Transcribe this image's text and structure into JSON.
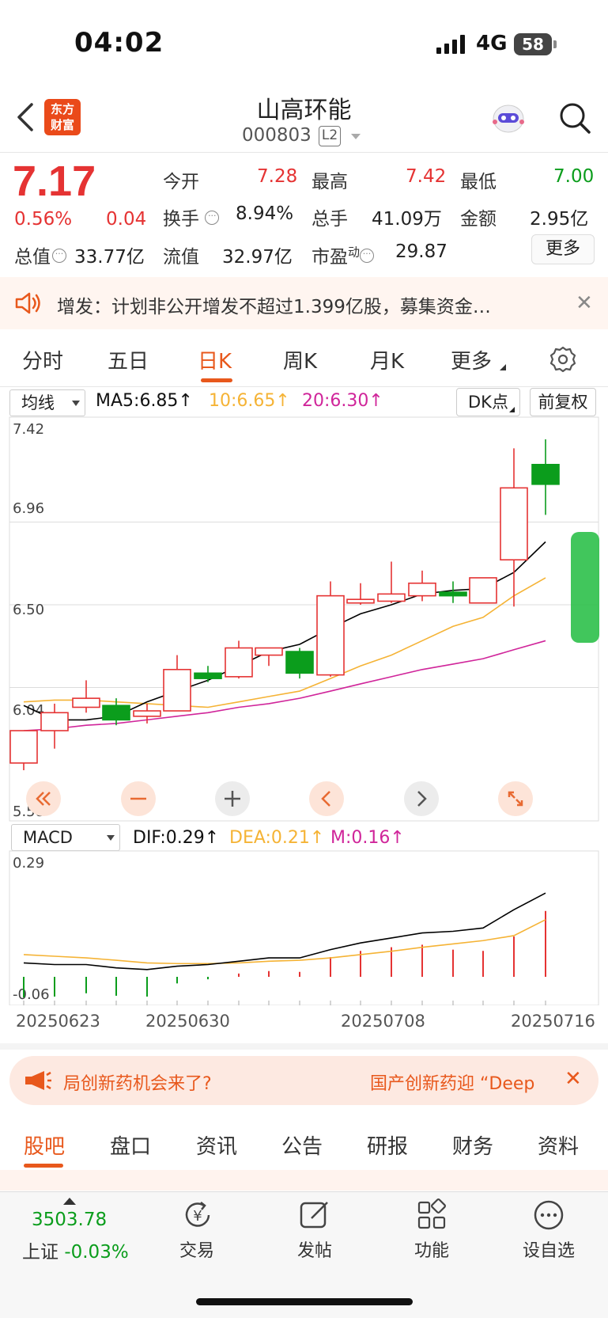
{
  "status_bar": {
    "time": "04:02",
    "network": "4G",
    "battery": "58"
  },
  "header": {
    "stock_name": "山高环能",
    "stock_code": "000803",
    "level_badge": "L2",
    "logo_text": "东方财富"
  },
  "quote": {
    "price": "7.17",
    "change_pct": "0.56%",
    "change": "0.04",
    "open_label": "今开",
    "open": "7.28",
    "high_label": "最高",
    "high": "7.42",
    "low_label": "最低",
    "low": "7.00",
    "turnover_label": "换手",
    "turnover": "8.94%",
    "volume_label": "总手",
    "volume": "41.09万",
    "amount_label": "金额",
    "amount": "2.95亿",
    "total_mv_label": "总值",
    "total_mv": "33.77亿",
    "float_mv_label": "流值",
    "float_mv": "32.97亿",
    "pe_label": "市盈",
    "pe_sup": "动",
    "pe": "29.87",
    "more_button": "更多"
  },
  "notice": {
    "text": "增发：计划非公开增发不超过1.399亿股，募集资金…"
  },
  "chart_tabs": [
    "分时",
    "五日",
    "日K",
    "周K",
    "月K",
    "更多"
  ],
  "ma_row": {
    "select": "均线",
    "ma5": "MA5:6.85",
    "ma10": "10:6.65",
    "ma20": "20:6.30",
    "dk_button": "DK点",
    "fq_button": "前复权"
  },
  "colors": {
    "red": "#e53333",
    "green": "#0b9d1c",
    "accent": "#e8581c",
    "ma5": "#000000",
    "ma10": "#f5b335",
    "ma20": "#d0259a"
  },
  "chart_data": [
    {
      "type": "candlestick",
      "yticks": [
        "7.42",
        "6.96",
        "6.50",
        "6.04",
        "5.58"
      ],
      "ylim": [
        5.58,
        7.42
      ],
      "candles": [
        {
          "o": 5.62,
          "c": 5.8,
          "h": 5.8,
          "l": 5.58
        },
        {
          "o": 5.8,
          "c": 5.9,
          "h": 5.95,
          "l": 5.7
        },
        {
          "o": 5.93,
          "c": 5.98,
          "h": 6.08,
          "l": 5.9
        },
        {
          "o": 5.94,
          "c": 5.86,
          "h": 5.98,
          "l": 5.83
        },
        {
          "o": 5.88,
          "c": 5.91,
          "h": 5.95,
          "l": 5.84
        },
        {
          "o": 5.91,
          "c": 6.14,
          "h": 6.22,
          "l": 5.91
        },
        {
          "o": 6.12,
          "c": 6.09,
          "h": 6.16,
          "l": 6.07
        },
        {
          "o": 6.1,
          "c": 6.26,
          "h": 6.3,
          "l": 6.09
        },
        {
          "o": 6.22,
          "c": 6.26,
          "h": 6.26,
          "l": 6.16
        },
        {
          "o": 6.24,
          "c": 6.12,
          "h": 6.26,
          "l": 6.09
        },
        {
          "o": 6.11,
          "c": 6.55,
          "h": 6.63,
          "l": 6.1
        },
        {
          "o": 6.51,
          "c": 6.53,
          "h": 6.62,
          "l": 6.5
        },
        {
          "o": 6.52,
          "c": 6.56,
          "h": 6.74,
          "l": 6.51
        },
        {
          "o": 6.55,
          "c": 6.62,
          "h": 6.69,
          "l": 6.52
        },
        {
          "o": 6.57,
          "c": 6.55,
          "h": 6.63,
          "l": 6.51
        },
        {
          "o": 6.51,
          "c": 6.65,
          "h": 6.65,
          "l": 6.51
        },
        {
          "o": 6.75,
          "c": 7.15,
          "h": 7.37,
          "l": 6.49
        },
        {
          "o": 7.28,
          "c": 7.17,
          "h": 7.42,
          "l": 7.0
        }
      ],
      "ma5": [
        5.94,
        5.86,
        5.86,
        5.88,
        5.96,
        6.02,
        6.08,
        6.16,
        6.24,
        6.28,
        6.37,
        6.45,
        6.5,
        6.56,
        6.58,
        6.59,
        6.68,
        6.85
      ],
      "ma10": [
        5.96,
        5.97,
        5.97,
        5.96,
        5.95,
        5.94,
        5.93,
        5.96,
        5.99,
        6.02,
        6.09,
        6.16,
        6.22,
        6.3,
        6.38,
        6.43,
        6.55,
        6.65
      ],
      "ma20": [
        5.8,
        5.81,
        5.83,
        5.84,
        5.86,
        5.88,
        5.9,
        5.93,
        5.95,
        5.98,
        6.02,
        6.06,
        6.1,
        6.14,
        6.17,
        6.2,
        6.25,
        6.3
      ]
    },
    {
      "type": "macd",
      "yticks": [
        "0.29",
        "-0.06"
      ],
      "ylim": [
        -0.06,
        0.29
      ],
      "dif": [
        0.08,
        0.075,
        0.075,
        0.065,
        0.06,
        0.07,
        0.075,
        0.085,
        0.095,
        0.095,
        0.12,
        0.14,
        0.155,
        0.17,
        0.175,
        0.185,
        0.24,
        0.29
      ],
      "dea": [
        0.105,
        0.1,
        0.095,
        0.088,
        0.08,
        0.078,
        0.078,
        0.08,
        0.085,
        0.088,
        0.095,
        0.105,
        0.115,
        0.127,
        0.137,
        0.147,
        0.162,
        0.21
      ],
      "macd": [
        -0.05,
        -0.048,
        -0.04,
        -0.046,
        -0.048,
        -0.016,
        -0.006,
        0.008,
        0.014,
        0.012,
        0.048,
        0.063,
        0.072,
        0.078,
        0.066,
        0.063,
        0.098,
        0.16
      ],
      "dates": [
        "20250623",
        "20250630",
        "20250708",
        "20250716"
      ]
    }
  ],
  "macd_row": {
    "select": "MACD",
    "dif": "DIF:0.29",
    "dea": "DEA:0.21",
    "m": "M:0.16"
  },
  "ad_banner": {
    "left": "局创新药机会来了?",
    "right": "国产创新药迎 “Deep"
  },
  "bottom_tabs": [
    "股吧",
    "盘口",
    "资讯",
    "公告",
    "研报",
    "财务",
    "资料"
  ],
  "bottom_nav": {
    "index_value": "3503.78",
    "index_name": "上证",
    "index_change": "-0.03%",
    "items": [
      "交易",
      "发帖",
      "功能",
      "设自选"
    ]
  }
}
